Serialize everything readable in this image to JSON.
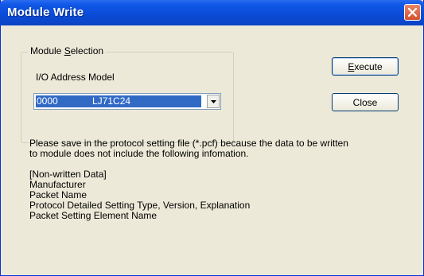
{
  "window": {
    "title": "Module Write"
  },
  "group": {
    "legend_prefix": "Module ",
    "legend_hotkey": "S",
    "legend_suffix": "election",
    "io_label": "I/O Address Model"
  },
  "combo": {
    "address": "0000",
    "model": "LJ71C24"
  },
  "buttons": {
    "execute_hotkey": "E",
    "execute_rest": "xecute",
    "close": "Close"
  },
  "message": {
    "line1": "Please save in the protocol setting file (*.pcf) because the data to be written",
    "line2": "to module does not include the following infomation.",
    "list": [
      "[Non-written Data]",
      "Manufacturer",
      "Packet Name",
      "Protocol Detailed Setting Type, Version, Explanation",
      "Packet Setting Element Name"
    ]
  },
  "colors": {
    "titlebar": "#0a4bd6",
    "selection": "#316ac5",
    "face": "#ece9d8",
    "close_button": "#d4522e"
  }
}
